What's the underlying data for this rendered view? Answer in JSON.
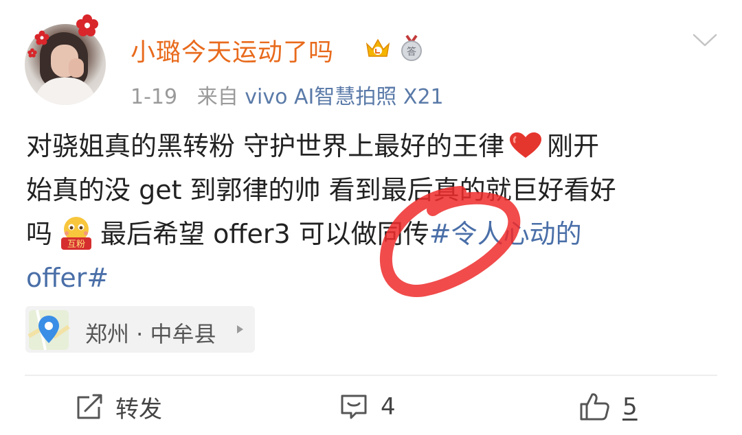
{
  "post": {
    "username": "小璐今天运动了吗",
    "date": "1-19",
    "source_label": "来自",
    "source": "vivo AI智慧拍照 X21",
    "lines": [
      {
        "before": "对骁姐真的黑转粉 守护世界上最好的王律",
        "after": "刚开"
      },
      {
        "text": "始真的没 get 到郭律的帅 看到最后真的就巨好看好"
      },
      {
        "before": "吗",
        "middle": "最后希望 offer3 可以做同传",
        "hashtag": "#令人心动的"
      },
      {
        "hashtag": "offer#"
      }
    ],
    "emoji_face_label": "互粉"
  },
  "location": {
    "text": "郑州 · 中牟县"
  },
  "actions": {
    "repost_label": "转发",
    "comment_count": "4",
    "like_count": "5"
  },
  "icons": {
    "crown_badge": "crown-badge-icon",
    "medal_badge": "medal-badge-icon",
    "location": "map-pin-icon",
    "repost": "share-icon",
    "comment": "comment-icon",
    "like": "thumbs-up-icon",
    "more": "chevron-down-icon"
  },
  "colors": {
    "username": "#e86a1c",
    "hashtag": "#4a6fa8",
    "annotation": "#e8282a"
  }
}
